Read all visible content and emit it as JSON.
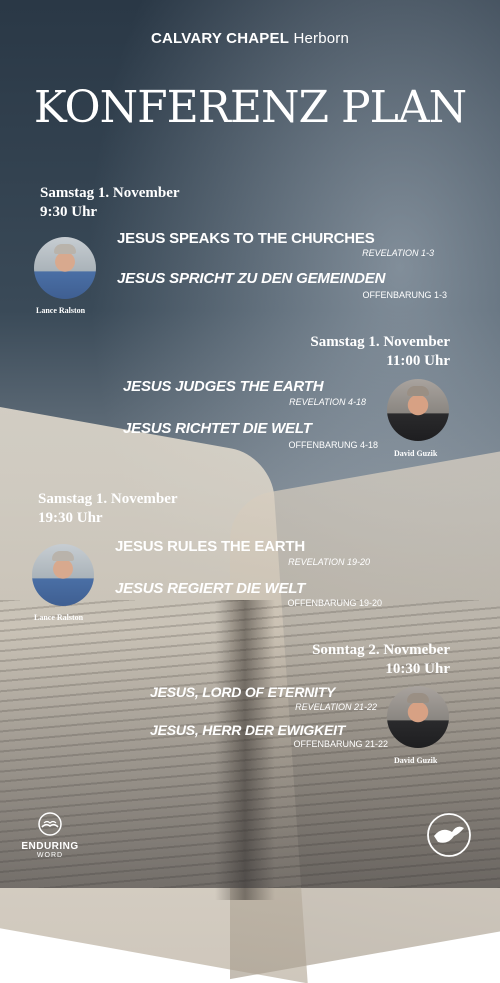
{
  "header": {
    "church_bold": "CALVARY CHAPEL",
    "church_light": "Herborn",
    "title": "KONFERENZ PLAN"
  },
  "sessions": [
    {
      "date": "Samstag 1. November",
      "time": "9:30 Uhr",
      "talk_en": "JESUS SPEAKS TO THE CHURCHES",
      "ref_en": "REVELATION 1-3",
      "talk_de": "JESUS SPRICHT ZU DEN GEMEINDEN",
      "ref_de": "OFFENBARUNG 1-3",
      "speaker": "Lance Ralston"
    },
    {
      "date": "Samstag 1. November",
      "time": "11:00 Uhr",
      "talk_en": "JESUS JUDGES THE EARTH",
      "ref_en": "REVELATION 4-18",
      "talk_de": "JESUS RICHTET DIE WELT",
      "ref_de": "OFFENBARUNG 4-18",
      "speaker": "David Guzik"
    },
    {
      "date": "Samstag 1. November",
      "time": "19:30 Uhr",
      "talk_en": "JESUS RULES THE EARTH",
      "ref_en": "REVELATION 19-20",
      "talk_de": "JESUS REGIERT DIE WELT",
      "ref_de": "OFFENBARUNG 19-20",
      "speaker": "Lance Ralston"
    },
    {
      "date": "Sonntag 2. Novmeber",
      "time": "10:30 Uhr",
      "talk_en": "JESUS, LORD OF ETERNITY",
      "ref_en": "REVELATION 21-22",
      "talk_de": "JESUS, HERR DER EWIGKEIT",
      "ref_de": "OFFENBARUNG 21-22",
      "speaker": "David Guzik"
    }
  ],
  "footer": {
    "logo_left_line1": "ENDURING",
    "logo_left_line2": "WORD"
  },
  "icons": [
    "book-icon",
    "dove-icon"
  ]
}
